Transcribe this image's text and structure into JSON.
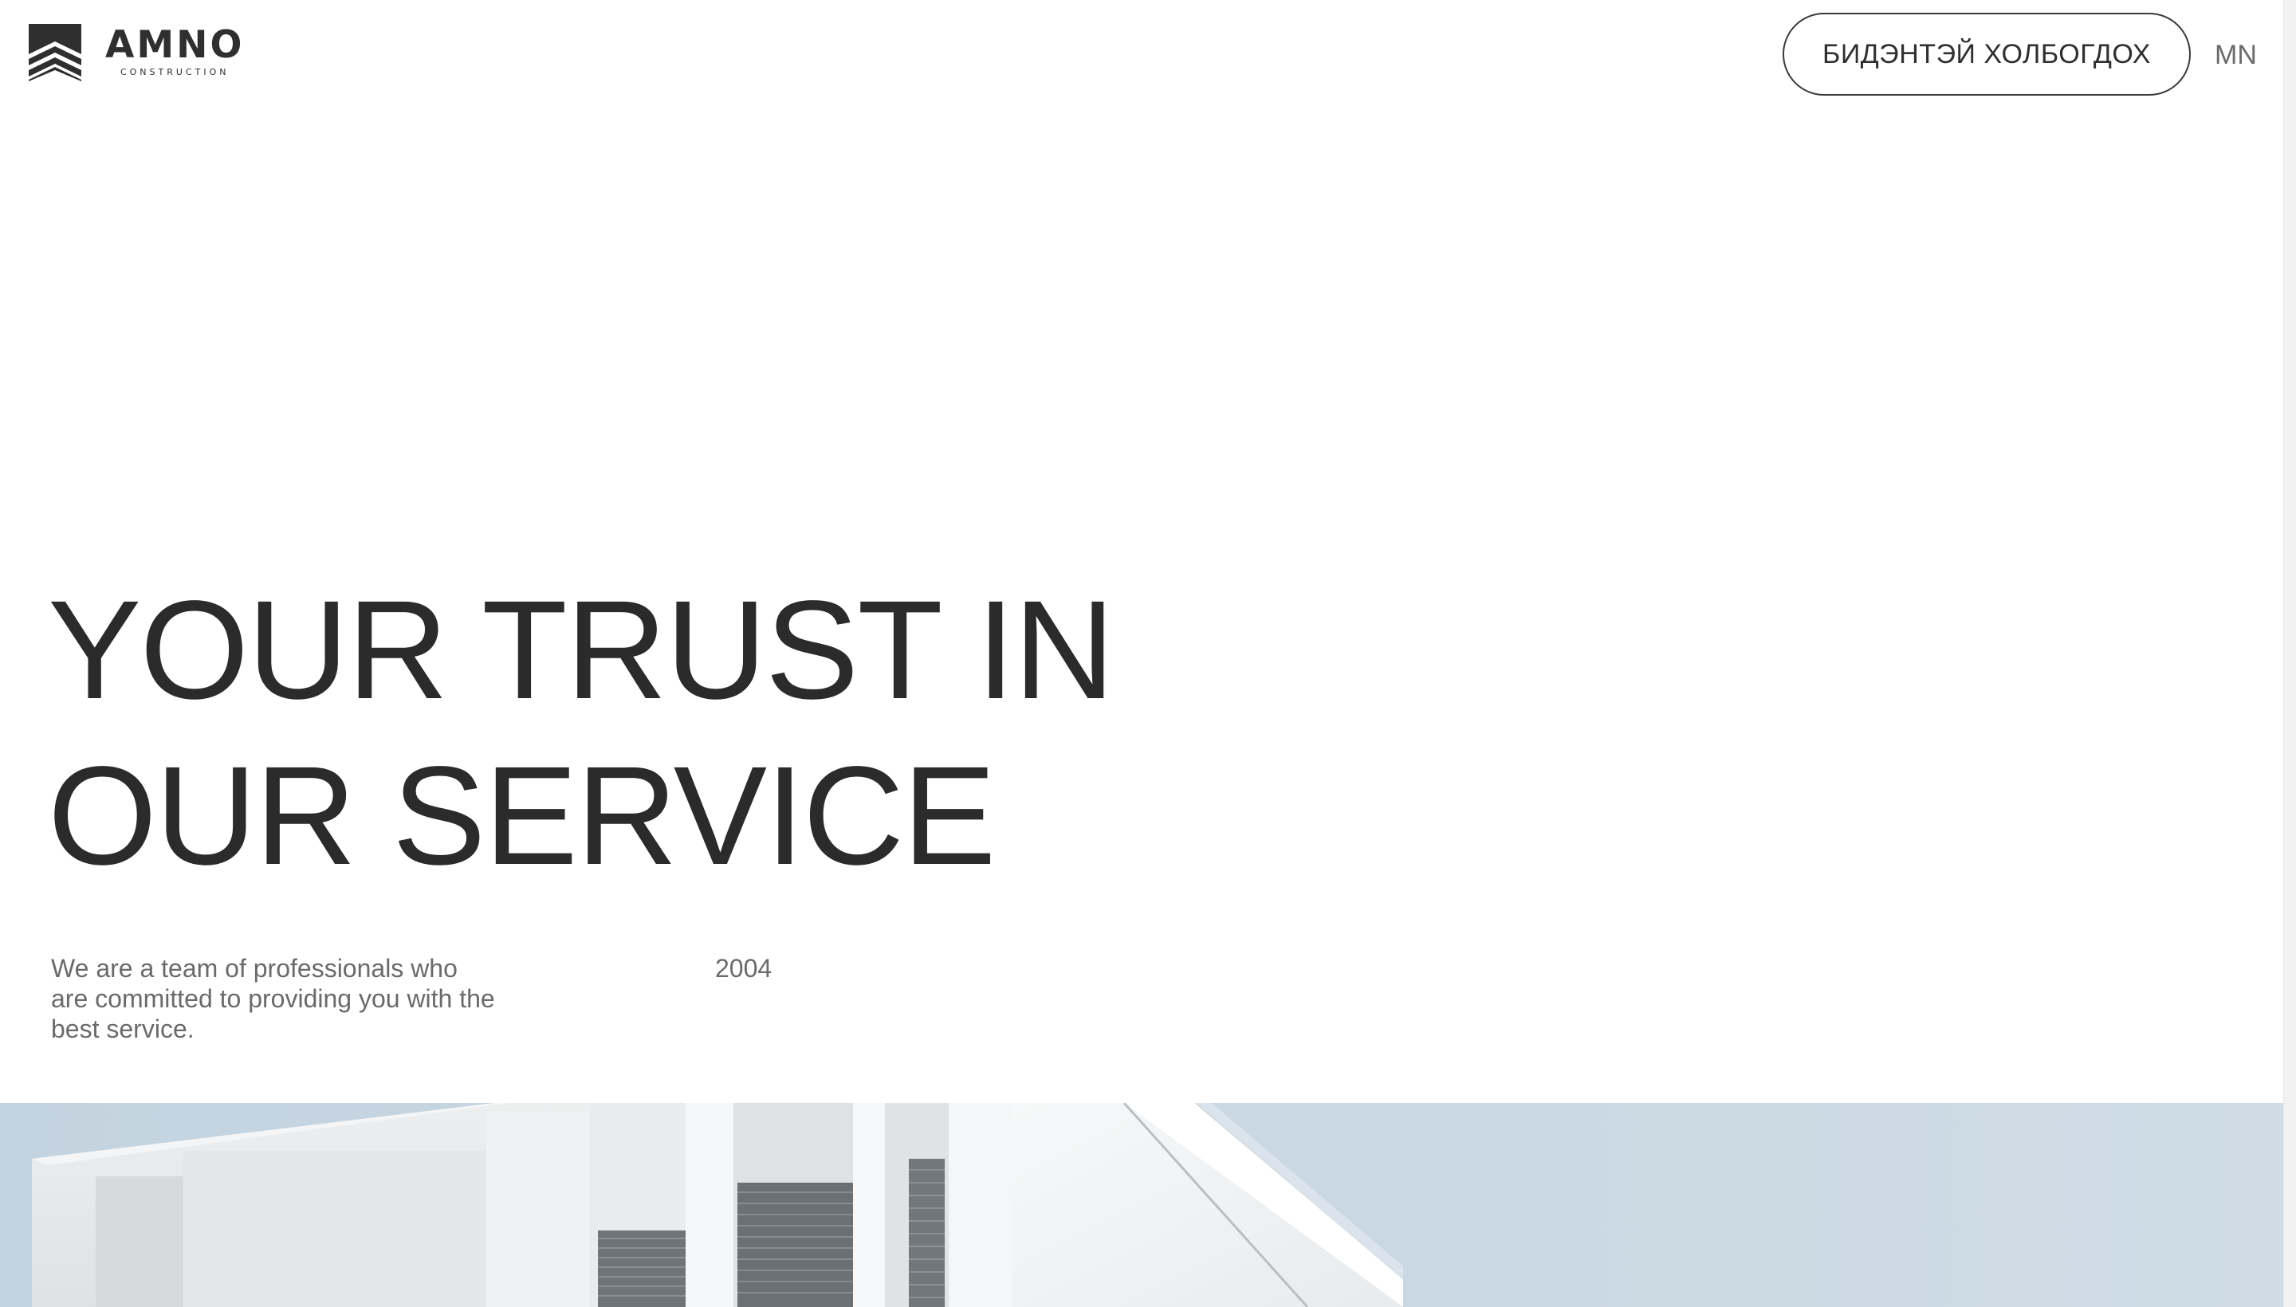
{
  "header": {
    "logo": {
      "name": "AMNO",
      "tagline": "CONSTRUCTION",
      "icon": "stacked-chevrons-logo-icon"
    },
    "contact_button_label": "БИДЭНТЭЙ ХОЛБОГДОХ",
    "language_label": "MN"
  },
  "hero": {
    "title_line_1": "YOUR TRUST IN",
    "title_line_2": "OUR SERVICE",
    "description": "We are a team of professionals who are committed to providing you with the best service.",
    "year": "2004",
    "image_subject": "white-building-facade-photo"
  },
  "colors": {
    "text_primary": "#2b2b2b",
    "text_secondary": "#6a6a6a",
    "button_border": "#3a3a3a",
    "sky": "#c9d8e3",
    "background": "#ffffff"
  }
}
